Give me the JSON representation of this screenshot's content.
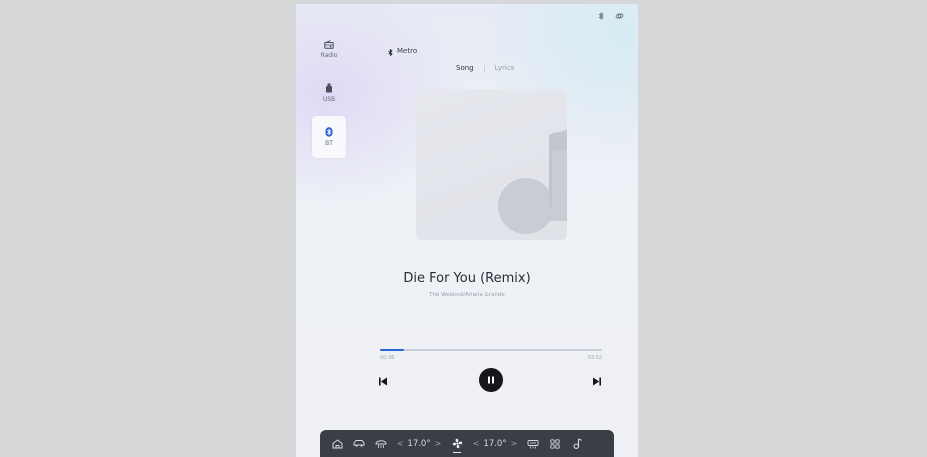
{
  "sources": [
    {
      "label": "Radio",
      "icon": "radio-icon",
      "active": false
    },
    {
      "label": "USB",
      "icon": "usb-icon",
      "active": false
    },
    {
      "label": "BT",
      "icon": "bluetooth-icon",
      "active": true
    }
  ],
  "device": {
    "name": "Metro",
    "icon": "bluetooth-icon"
  },
  "tabs": [
    {
      "label": "Song",
      "active": true
    },
    {
      "label": "Lyrics",
      "active": false
    }
  ],
  "track": {
    "title": "Die For You (Remix)",
    "artist": "The Weeknd/Ariana Grande",
    "current_time": "00:36",
    "total_time": "03:52",
    "progress_fraction": 0.11
  },
  "dock": {
    "left_temp": "17.0°",
    "right_temp": "17.0°",
    "decrease_glyph": "<",
    "increase_glyph": ">"
  },
  "colors": {
    "accent": "#2a63d6",
    "dock_bg": "#3b3e44",
    "play_button": "#15171b"
  }
}
